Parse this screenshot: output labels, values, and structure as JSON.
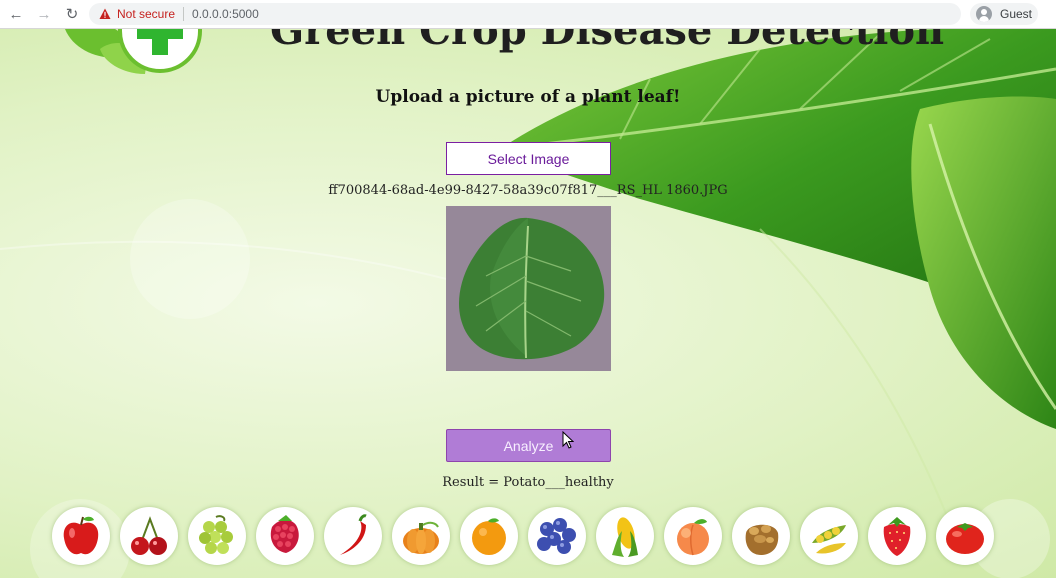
{
  "browser": {
    "security_label": "Not secure",
    "url": "0.0.0.0:5000",
    "profile_label": "Guest"
  },
  "page": {
    "title": "Green Crop Disease Detection",
    "upload_heading": "Upload a picture of a plant leaf!",
    "select_button": "Select Image",
    "file_name": "ff700844-68ad-4e99-8427-58a39c07f817___RS_HL 1860.JPG",
    "analyze_button": "Analyze",
    "result_text": "Result = Potato___healthy"
  },
  "fruits": [
    "apple",
    "cherry",
    "grape",
    "raspberry",
    "chili",
    "pumpkin",
    "orange",
    "blueberry",
    "corn",
    "peach",
    "potato",
    "soybean",
    "strawberry",
    "tomato"
  ],
  "colors": {
    "accent_purple": "#7b1fa2",
    "analyze_bg": "#b07cd6",
    "not_secure": "#c5221f",
    "leaf_green": "#2e8b22"
  }
}
